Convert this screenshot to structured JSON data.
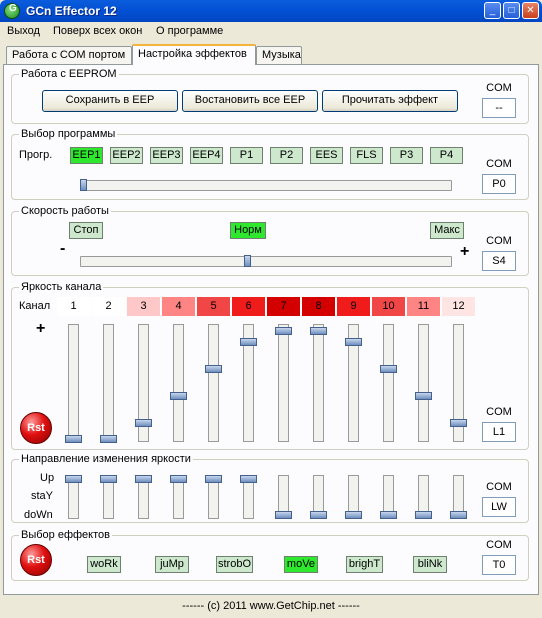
{
  "window": {
    "title": "GCn Effector 12"
  },
  "menu": [
    "Выход",
    "Поверх всех окон",
    "О программе"
  ],
  "tabs": [
    "Работа с COM портом",
    "Настройка эффектов",
    "Музыка"
  ],
  "eeprom": {
    "title": "Работа с EEPROM",
    "buttons": [
      "Сохранить в EEP",
      "Востановить все EEP",
      "Прочитать эффект"
    ],
    "com_label": "COM",
    "com_value": "--"
  },
  "program": {
    "title": "Выбор программы",
    "label": "Прогр.",
    "buttons": [
      "EEP1",
      "EEP2",
      "EEP3",
      "EEP4",
      "P1",
      "P2",
      "EES",
      "FLS",
      "P3",
      "P4"
    ],
    "active_index": 0,
    "slider_value": 0,
    "com_label": "COM",
    "com_value": "P0"
  },
  "speed": {
    "title": "Скорость работы",
    "stop": "Стоп",
    "norm": "Норм",
    "max": "Макс",
    "minus": "-",
    "plus": "+",
    "slider_value": 0.45,
    "com_label": "COM",
    "com_value": "S4"
  },
  "brightness": {
    "title": "Яркость канала",
    "channel_label": "Канал",
    "plus": "+",
    "channels": [
      "1",
      "2",
      "3",
      "4",
      "5",
      "6",
      "7",
      "8",
      "9",
      "10",
      "11",
      "12"
    ],
    "channel_colors": [
      "#ffffff",
      "#ffffff",
      "#ffc8c8",
      "#ff8484",
      "#f04646",
      "#f01c1c",
      "#d40000",
      "#d40000",
      "#f01c1c",
      "#f04646",
      "#ff8484",
      "#ffe4e4"
    ],
    "levels": [
      0,
      0,
      0.15,
      0.4,
      0.65,
      0.9,
      1,
      1,
      0.9,
      0.65,
      0.4,
      0.15
    ],
    "rst": "Rst",
    "com_label": "COM",
    "com_value": "L1"
  },
  "direction": {
    "title": "Направление изменения яркости",
    "labels": [
      "Up",
      "staY",
      "doWn"
    ],
    "states": [
      "up",
      "up",
      "up",
      "up",
      "up",
      "up",
      "down",
      "down",
      "down",
      "down",
      "down",
      "down"
    ],
    "com_label": "COM",
    "com_value": "LW"
  },
  "effects": {
    "title": "Выбор еффектов",
    "buttons": [
      "woRk",
      "juMp",
      "strobO",
      "moVe",
      "brighT",
      "bliNk"
    ],
    "active_index": 3,
    "rst": "Rst",
    "com_label": "COM",
    "com_value": "T0"
  },
  "status": "------  (c) 2011  www.GetChip.net  ------",
  "colors": {
    "active_green": "#2ee82e",
    "button_green": "#cde8cd",
    "titlebar": "#0350d4"
  }
}
